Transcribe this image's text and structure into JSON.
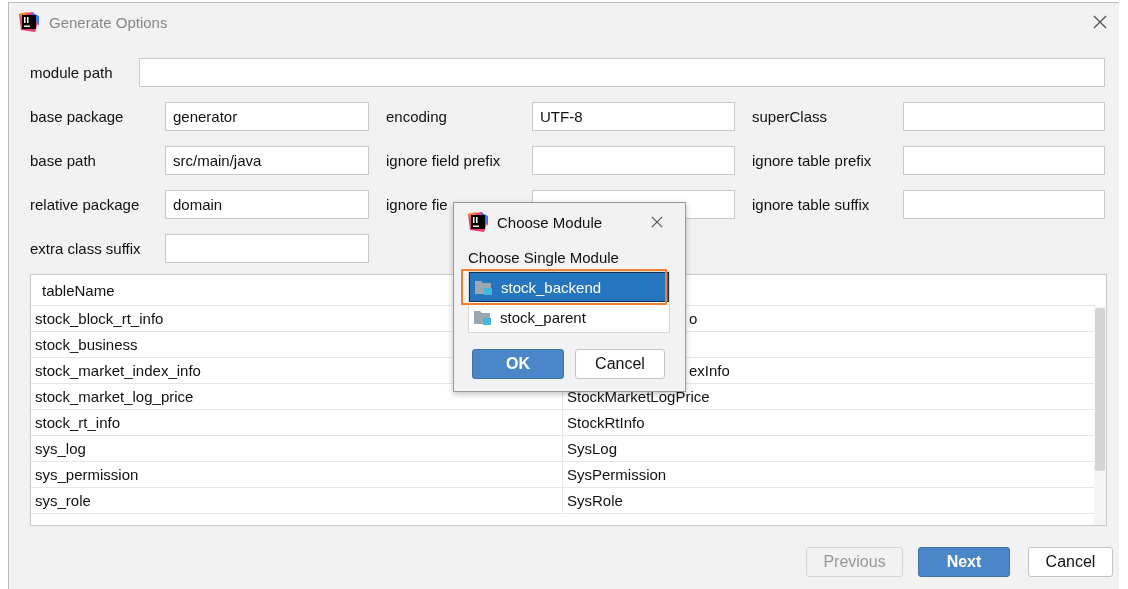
{
  "window": {
    "title": "Generate Options"
  },
  "module_path": {
    "label": "module path"
  },
  "form_rows": [
    {
      "fields": [
        {
          "label": "base package",
          "value": "generator"
        },
        {
          "label": "encoding",
          "value": "UTF-8"
        },
        {
          "label": "superClass"
        }
      ]
    },
    {
      "fields": [
        {
          "label": "base path",
          "value": "src/main/java"
        },
        {
          "label": "ignore field prefix"
        },
        {
          "label": "ignore table prefix"
        }
      ]
    },
    {
      "fields": [
        {
          "label": "relative package",
          "value": "domain"
        },
        {
          "label": "ignore fie"
        },
        {
          "label": "ignore table suffix"
        }
      ]
    },
    {
      "fields": [
        {
          "label": "extra class suffix"
        }
      ]
    }
  ],
  "table": {
    "columns": [
      "tableName"
    ],
    "rows": [
      {
        "table_name": "stock_block_rt_info",
        "class_name": "o",
        "kind": "partial"
      },
      {
        "table_name": "stock_business"
      },
      {
        "table_name": "stock_market_index_info",
        "class_name": "exInfo",
        "kind": "partial"
      },
      {
        "table_name": "stock_market_log_price",
        "class_name": "StockMarketLogPrice",
        "kind": "full"
      },
      {
        "table_name": "stock_rt_info",
        "class_name": "StockRtInfo",
        "kind": "full"
      },
      {
        "table_name": "sys_log",
        "class_name": "SysLog",
        "kind": "full"
      },
      {
        "table_name": "sys_permission",
        "class_name": "SysPermission",
        "kind": "full"
      },
      {
        "table_name": "sys_role",
        "class_name": "SysRole",
        "kind": "full"
      }
    ]
  },
  "popup": {
    "title": "Choose Module",
    "prompt": "Choose Single Module",
    "modules": [
      {
        "label": "stock_backend",
        "selected": true,
        "annotated": true
      },
      {
        "label": "stock_parent",
        "selected": false,
        "annotated": false
      }
    ],
    "buttons": [
      {
        "label": "OK",
        "primary": true
      },
      {
        "label": "Cancel",
        "primary": false
      }
    ]
  },
  "buttons": [
    {
      "label": "Previous",
      "primary": false,
      "disabled": true
    },
    {
      "label": "Next",
      "primary": true,
      "disabled": false
    },
    {
      "label": "Cancel",
      "primary": false,
      "disabled": false
    }
  ]
}
